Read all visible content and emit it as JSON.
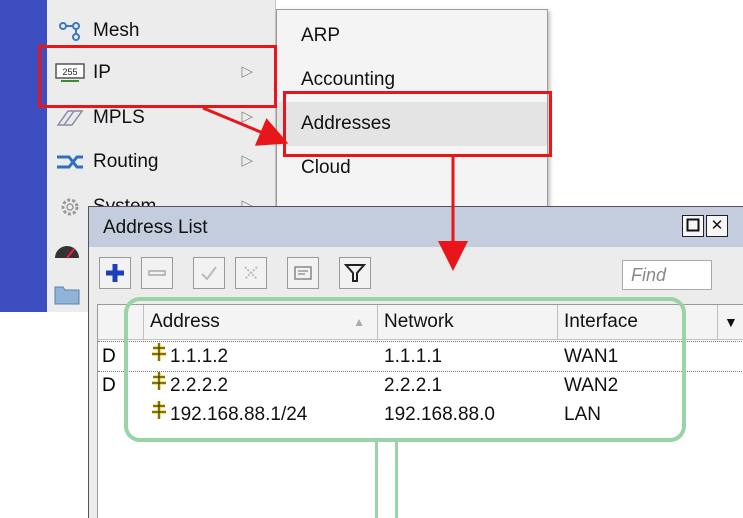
{
  "main_menu": {
    "items": [
      {
        "label": "Mesh",
        "icon": "mesh-icon",
        "has_submenu": false
      },
      {
        "label": "IP",
        "icon": "ip-255-icon",
        "has_submenu": true
      },
      {
        "label": "MPLS",
        "icon": "mpls-icon",
        "has_submenu": true
      },
      {
        "label": "Routing",
        "icon": "routing-icon",
        "has_submenu": true
      },
      {
        "label": "System",
        "icon": "system-gear-icon",
        "has_submenu": true
      }
    ]
  },
  "submenu": {
    "items": [
      {
        "label": "ARP"
      },
      {
        "label": "Accounting"
      },
      {
        "label": "Addresses"
      },
      {
        "label": "Cloud"
      }
    ]
  },
  "window": {
    "title": "Address List",
    "find_placeholder": "Find",
    "toolbar": [
      "add-icon",
      "remove-icon",
      "enable-check-icon",
      "disable-x-icon",
      "comment-icon",
      "filter-icon"
    ],
    "columns": [
      "Address",
      "Network",
      "Interface"
    ],
    "rows": [
      {
        "flag": "D",
        "address": "1.1.1.2",
        "network": "1.1.1.1",
        "interface": "WAN1"
      },
      {
        "flag": "D",
        "address": "2.2.2.2",
        "network": "2.2.2.1",
        "interface": "WAN2"
      },
      {
        "flag": "",
        "address": "192.168.88.1/24",
        "network": "192.168.88.0",
        "interface": "LAN"
      }
    ]
  },
  "colors": {
    "sidebar": "#3d4ec0",
    "highlight_red": "#e8161b",
    "highlight_green": "#9ad4a6",
    "titlebar": "#c4cddd"
  }
}
